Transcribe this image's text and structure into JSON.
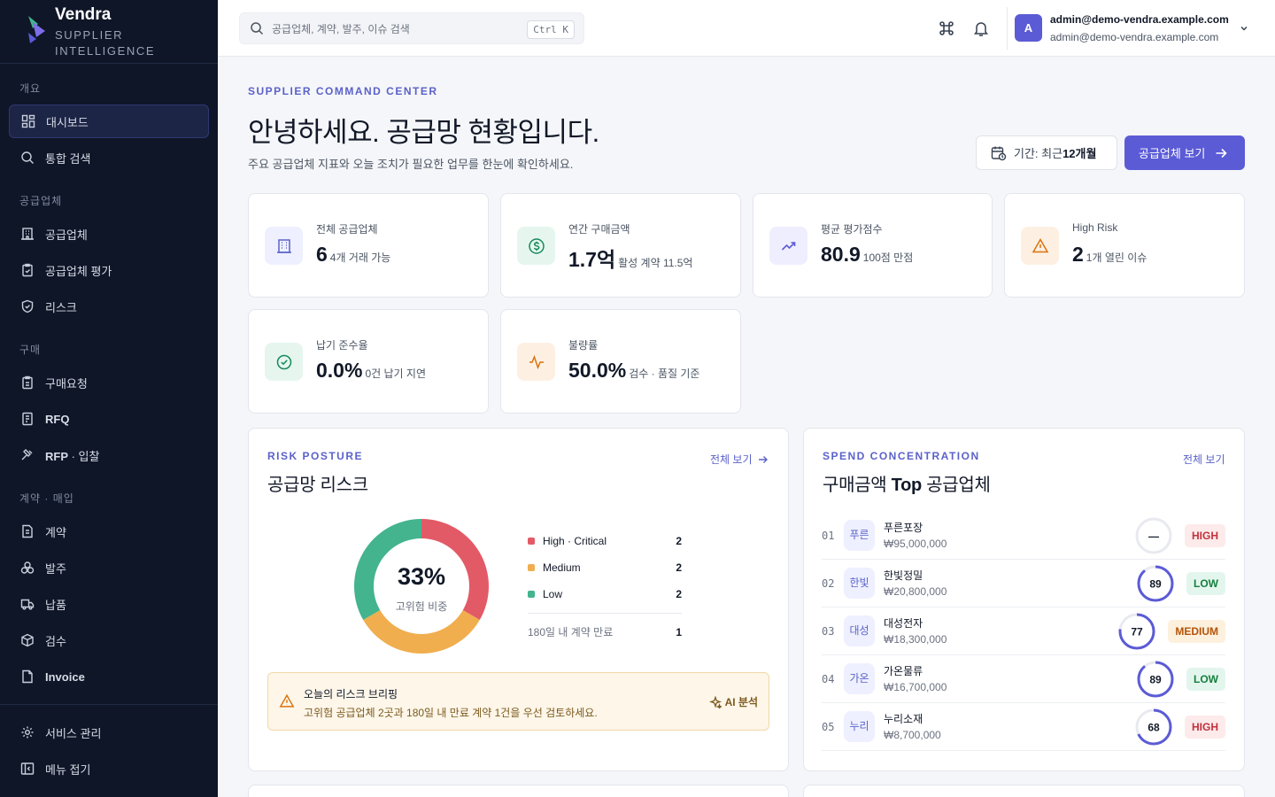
{
  "brand": {
    "name": "Vendra",
    "line1": "SUPPLIER",
    "line2": "INTELLIGENCE"
  },
  "sidebar": {
    "sections": [
      "개요",
      "공급업체",
      "구매",
      "계약 · 매입"
    ],
    "items": [
      {
        "label": "대시보드",
        "icon": "dashboard-grid-icon",
        "active": true
      },
      {
        "label": "통합 검색",
        "icon": "search-icon"
      },
      {
        "label": "공급업체",
        "icon": "building-icon"
      },
      {
        "label": "공급업체 평가",
        "icon": "clipboard-check-icon"
      },
      {
        "label": "리스크",
        "icon": "shield-icon"
      },
      {
        "label": "구매요청",
        "icon": "clipboard-icon"
      },
      {
        "label": "RFQ",
        "icon": "document-list-icon"
      },
      {
        "label_strong": "RFP",
        "label": " · 입찰",
        "icon": "gavel-icon"
      },
      {
        "label": "계약",
        "icon": "document-icon"
      },
      {
        "label": "발주",
        "icon": "boxes-icon"
      },
      {
        "label": "납품",
        "icon": "truck-icon"
      },
      {
        "label": "검수",
        "icon": "package-icon"
      },
      {
        "label": "Invoice",
        "icon": "file-icon"
      },
      {
        "label": "서비스 관리",
        "icon": "gear-icon"
      },
      {
        "label": "메뉴 접기",
        "icon": "collapse-panel-icon"
      }
    ]
  },
  "topbar": {
    "search_placeholder": "공급업체, 계약, 발주, 이슈 검색",
    "shortcut": "Ctrl K",
    "user_email": "admin@demo-vendra.example.com",
    "user_sub": "admin@demo-vendra.example.com",
    "avatar": "A"
  },
  "header": {
    "eyebrow": "SUPPLIER COMMAND CENTER",
    "title": "안녕하세요. 공급망 현황입니다.",
    "subtitle": "주요 공급업체 지표와 오늘 조치가 필요한 업무를 한눈에 확인하세요.",
    "period_label": "기간: 최근 ",
    "period_value": "12개월",
    "cta": "공급업체 보기"
  },
  "kpis": [
    {
      "label": "전체 공급업체",
      "value": "6",
      "note": "4개 거래 가능",
      "icon": "building-icon",
      "bg": "#eef0ff",
      "fg": "#5b62c9"
    },
    {
      "label": "연간 구매금액",
      "value": "1.7억",
      "note": "활성 계약 11.5억",
      "icon": "dollar-circle-icon",
      "bg": "#e6f6ef",
      "fg": "#16895b"
    },
    {
      "label": "평균 평가점수",
      "value": "80.9",
      "note": "100점 만점",
      "icon": "trending-up-icon",
      "bg": "#efeefe",
      "fg": "#5b5bd6"
    },
    {
      "label": "High Risk",
      "value": "2",
      "note": "1개 열린 이슈",
      "icon": "warning-triangle-icon",
      "bg": "#fdf0e3",
      "fg": "#d9730d"
    },
    {
      "label": "납기 준수율",
      "value": "0.0%",
      "note": "0건 납기 지연",
      "icon": "check-circle-icon",
      "bg": "#e6f6ef",
      "fg": "#16895b"
    },
    {
      "label": "불량률",
      "value": "50.0%",
      "note": "검수 · 품질 기준",
      "icon": "activity-icon",
      "bg": "#fdf0e3",
      "fg": "#d9730d"
    }
  ],
  "risk": {
    "eyebrow": "RISK POSTURE",
    "title": "공급망 리스크",
    "link": "전체 보기",
    "center_value": "33%",
    "center_label": "고위험 비중",
    "legend": [
      {
        "label": "High · Critical",
        "value": 2,
        "color": "#e35a67"
      },
      {
        "label": "Medium",
        "value": 2,
        "color": "#f0ae4e"
      },
      {
        "label": "Low",
        "value": 2,
        "color": "#43b48d"
      }
    ],
    "expiring_label": "180일 내 계약 만료",
    "expiring_value": "1",
    "briefing_title": "오늘의 리스크 브리핑",
    "briefing_text": "고위험 공급업체 2곳과 180일 내 만료 계약 1건을 우선 검토하세요.",
    "ai_label": "AI 분석"
  },
  "spend": {
    "eyebrow": "SPEND CONCENTRATION",
    "title_pre": "구매금액 ",
    "title_strong": "Top",
    "title_post": " 공급업체",
    "link": "전체 보기",
    "rows": [
      {
        "rank": "01",
        "abbr": "푸른",
        "name": "푸른포장",
        "amount": "₩95,000,000",
        "score": "—",
        "score_value": null,
        "risk": "HIGH"
      },
      {
        "rank": "02",
        "abbr": "한빛",
        "name": "한빛정밀",
        "amount": "₩20,800,000",
        "score": "89",
        "score_value": 89,
        "risk": "LOW"
      },
      {
        "rank": "03",
        "abbr": "대성",
        "name": "대성전자",
        "amount": "₩18,300,000",
        "score": "77",
        "score_value": 77,
        "risk": "MEDIUM"
      },
      {
        "rank": "04",
        "abbr": "가온",
        "name": "가온물류",
        "amount": "₩16,700,000",
        "score": "89",
        "score_value": 89,
        "risk": "LOW"
      },
      {
        "rank": "05",
        "abbr": "누리",
        "name": "누리소재",
        "amount": "₩8,700,000",
        "score": "68",
        "score_value": 68,
        "risk": "HIGH"
      }
    ]
  }
}
